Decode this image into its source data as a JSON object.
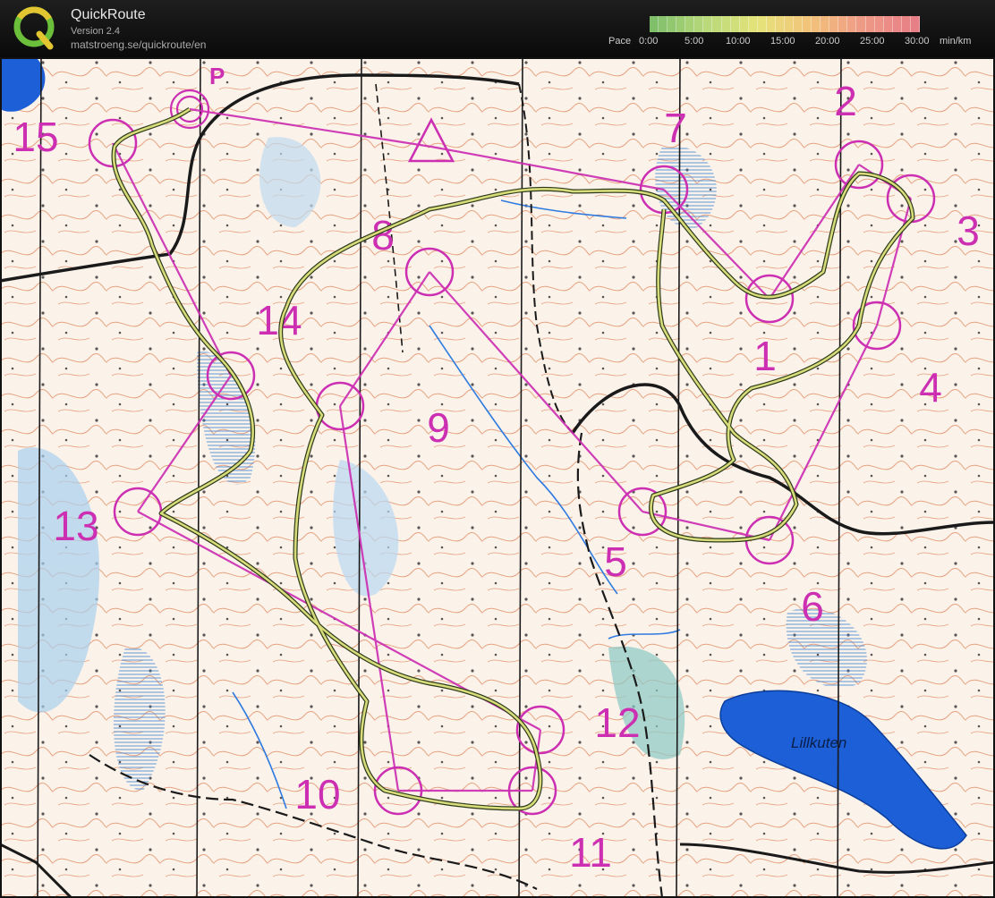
{
  "app": {
    "name": "QuickRoute",
    "version": "Version 2.4",
    "website": "matstroeng.se/quickroute/en"
  },
  "pace_legend": {
    "title": "Pace",
    "ticks": [
      "0:00",
      "5:00",
      "10:00",
      "15:00",
      "20:00",
      "25:00",
      "30:00"
    ],
    "unit": "min/km",
    "gradient": [
      "#7fbf6a",
      "#b7d97a",
      "#e6e37a",
      "#f2c27a",
      "#ee9a86",
      "#e77f86"
    ]
  },
  "map": {
    "lake_name": "Lillkuten",
    "parking_symbol": "P",
    "control_numbers": [
      "1",
      "2",
      "3",
      "4",
      "5",
      "6",
      "7",
      "8",
      "9",
      "10",
      "11",
      "12",
      "13",
      "14",
      "15"
    ],
    "colors": {
      "paper": "#fbf2ea",
      "contour": "#e0865a",
      "water": "#1c5fd6",
      "marsh": "#5ea1df",
      "course": "#cc2fb2",
      "route": "#d7db7a",
      "route_outline": "#2c3a1a",
      "road": "#1a1a1a"
    }
  }
}
